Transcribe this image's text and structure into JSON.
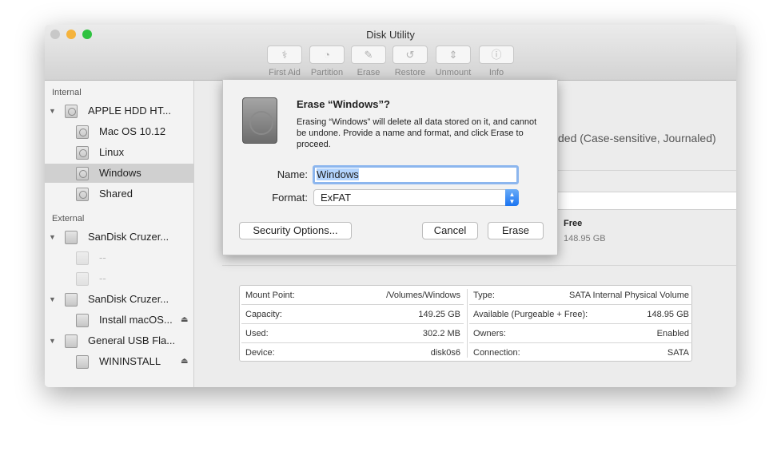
{
  "window": {
    "title": "Disk Utility",
    "lights": [
      "#c8c8c8",
      "#f5b33c",
      "#2fc240"
    ]
  },
  "toolbar": [
    {
      "label": "First Aid",
      "icon": "stethoscope-icon",
      "glyph": "⚕"
    },
    {
      "label": "Partition",
      "icon": "pie-icon",
      "glyph": "◔"
    },
    {
      "label": "Erase",
      "icon": "erase-icon",
      "glyph": "✎"
    },
    {
      "label": "Restore",
      "icon": "restore-icon",
      "glyph": "↺"
    },
    {
      "label": "Unmount",
      "icon": "unmount-icon",
      "glyph": "⇕"
    },
    {
      "label": "Info",
      "icon": "info-icon",
      "glyph": "ⓘ"
    }
  ],
  "sidebar": {
    "internal": "Internal",
    "external": "External",
    "items": [
      {
        "label": "APPLE HDD HT...",
        "level": 0,
        "kind": "hdd"
      },
      {
        "label": "Mac OS 10.12",
        "level": 1,
        "kind": "hdd"
      },
      {
        "label": "Linux",
        "level": 1,
        "kind": "hdd"
      },
      {
        "label": "Windows",
        "level": 1,
        "kind": "hdd",
        "selected": true
      },
      {
        "label": "Shared",
        "level": 1,
        "kind": "hdd"
      },
      {
        "label": "SanDisk Cruzer...",
        "level": 0,
        "kind": "usb"
      },
      {
        "label": "--",
        "level": 1,
        "kind": "usb",
        "dim": true
      },
      {
        "label": "--",
        "level": 1,
        "kind": "usb",
        "dim": true
      },
      {
        "label": "SanDisk Cruzer...",
        "level": 0,
        "kind": "usb"
      },
      {
        "label": "Install macOS...",
        "level": 1,
        "kind": "usb",
        "eject": true
      },
      {
        "label": "General USB Fla...",
        "level": 0,
        "kind": "usb"
      },
      {
        "label": "WININSTALL",
        "level": 1,
        "kind": "usb",
        "eject": true
      }
    ]
  },
  "main": {
    "format_text": "ded (Case-sensitive, Journaled)",
    "free_label": "Free",
    "free_value": "148.95 GB"
  },
  "dialog": {
    "title": "Erase “Windows”?",
    "message": "Erasing “Windows” will delete all data stored on it, and cannot be undone. Provide a name and format, and click Erase to proceed.",
    "name_label": "Name:",
    "name_value": "Windows",
    "format_label": "Format:",
    "format_value": "ExFAT",
    "security": "Security Options...",
    "cancel": "Cancel",
    "erase": "Erase"
  },
  "info": {
    "left": [
      {
        "k": "Mount Point:",
        "v": "/Volumes/Windows"
      },
      {
        "k": "Capacity:",
        "v": "149.25 GB"
      },
      {
        "k": "Used:",
        "v": "302.2 MB"
      },
      {
        "k": "Device:",
        "v": "disk0s6"
      }
    ],
    "right": [
      {
        "k": "Type:",
        "v": "SATA Internal Physical Volume"
      },
      {
        "k": "Available (Purgeable + Free):",
        "v": "148.95 GB"
      },
      {
        "k": "Owners:",
        "v": "Enabled"
      },
      {
        "k": "Connection:",
        "v": "SATA"
      }
    ]
  }
}
